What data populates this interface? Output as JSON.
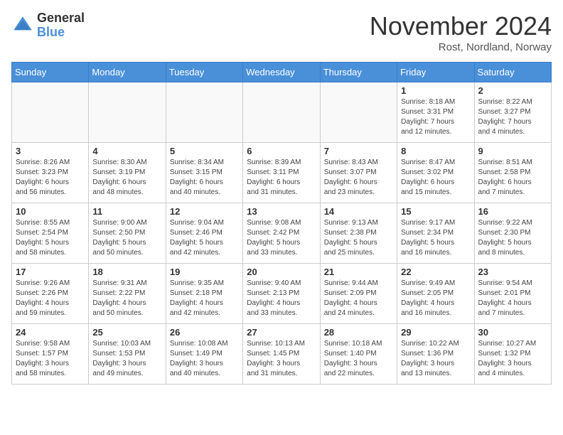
{
  "logo": {
    "general": "General",
    "blue": "Blue"
  },
  "header": {
    "month": "November 2024",
    "location": "Rost, Nordland, Norway"
  },
  "weekdays": [
    "Sunday",
    "Monday",
    "Tuesday",
    "Wednesday",
    "Thursday",
    "Friday",
    "Saturday"
  ],
  "weeks": [
    [
      {
        "day": "",
        "info": ""
      },
      {
        "day": "",
        "info": ""
      },
      {
        "day": "",
        "info": ""
      },
      {
        "day": "",
        "info": ""
      },
      {
        "day": "",
        "info": ""
      },
      {
        "day": "1",
        "info": "Sunrise: 8:18 AM\nSunset: 3:31 PM\nDaylight: 7 hours\nand 12 minutes."
      },
      {
        "day": "2",
        "info": "Sunrise: 8:22 AM\nSunset: 3:27 PM\nDaylight: 7 hours\nand 4 minutes."
      }
    ],
    [
      {
        "day": "3",
        "info": "Sunrise: 8:26 AM\nSunset: 3:23 PM\nDaylight: 6 hours\nand 56 minutes."
      },
      {
        "day": "4",
        "info": "Sunrise: 8:30 AM\nSunset: 3:19 PM\nDaylight: 6 hours\nand 48 minutes."
      },
      {
        "day": "5",
        "info": "Sunrise: 8:34 AM\nSunset: 3:15 PM\nDaylight: 6 hours\nand 40 minutes."
      },
      {
        "day": "6",
        "info": "Sunrise: 8:39 AM\nSunset: 3:11 PM\nDaylight: 6 hours\nand 31 minutes."
      },
      {
        "day": "7",
        "info": "Sunrise: 8:43 AM\nSunset: 3:07 PM\nDaylight: 6 hours\nand 23 minutes."
      },
      {
        "day": "8",
        "info": "Sunrise: 8:47 AM\nSunset: 3:02 PM\nDaylight: 6 hours\nand 15 minutes."
      },
      {
        "day": "9",
        "info": "Sunrise: 8:51 AM\nSunset: 2:58 PM\nDaylight: 6 hours\nand 7 minutes."
      }
    ],
    [
      {
        "day": "10",
        "info": "Sunrise: 8:55 AM\nSunset: 2:54 PM\nDaylight: 5 hours\nand 58 minutes."
      },
      {
        "day": "11",
        "info": "Sunrise: 9:00 AM\nSunset: 2:50 PM\nDaylight: 5 hours\nand 50 minutes."
      },
      {
        "day": "12",
        "info": "Sunrise: 9:04 AM\nSunset: 2:46 PM\nDaylight: 5 hours\nand 42 minutes."
      },
      {
        "day": "13",
        "info": "Sunrise: 9:08 AM\nSunset: 2:42 PM\nDaylight: 5 hours\nand 33 minutes."
      },
      {
        "day": "14",
        "info": "Sunrise: 9:13 AM\nSunset: 2:38 PM\nDaylight: 5 hours\nand 25 minutes."
      },
      {
        "day": "15",
        "info": "Sunrise: 9:17 AM\nSunset: 2:34 PM\nDaylight: 5 hours\nand 16 minutes."
      },
      {
        "day": "16",
        "info": "Sunrise: 9:22 AM\nSunset: 2:30 PM\nDaylight: 5 hours\nand 8 minutes."
      }
    ],
    [
      {
        "day": "17",
        "info": "Sunrise: 9:26 AM\nSunset: 2:26 PM\nDaylight: 4 hours\nand 59 minutes."
      },
      {
        "day": "18",
        "info": "Sunrise: 9:31 AM\nSunset: 2:22 PM\nDaylight: 4 hours\nand 50 minutes."
      },
      {
        "day": "19",
        "info": "Sunrise: 9:35 AM\nSunset: 2:18 PM\nDaylight: 4 hours\nand 42 minutes."
      },
      {
        "day": "20",
        "info": "Sunrise: 9:40 AM\nSunset: 2:13 PM\nDaylight: 4 hours\nand 33 minutes."
      },
      {
        "day": "21",
        "info": "Sunrise: 9:44 AM\nSunset: 2:09 PM\nDaylight: 4 hours\nand 24 minutes."
      },
      {
        "day": "22",
        "info": "Sunrise: 9:49 AM\nSunset: 2:05 PM\nDaylight: 4 hours\nand 16 minutes."
      },
      {
        "day": "23",
        "info": "Sunrise: 9:54 AM\nSunset: 2:01 PM\nDaylight: 4 hours\nand 7 minutes."
      }
    ],
    [
      {
        "day": "24",
        "info": "Sunrise: 9:58 AM\nSunset: 1:57 PM\nDaylight: 3 hours\nand 58 minutes."
      },
      {
        "day": "25",
        "info": "Sunrise: 10:03 AM\nSunset: 1:53 PM\nDaylight: 3 hours\nand 49 minutes."
      },
      {
        "day": "26",
        "info": "Sunrise: 10:08 AM\nSunset: 1:49 PM\nDaylight: 3 hours\nand 40 minutes."
      },
      {
        "day": "27",
        "info": "Sunrise: 10:13 AM\nSunset: 1:45 PM\nDaylight: 3 hours\nand 31 minutes."
      },
      {
        "day": "28",
        "info": "Sunrise: 10:18 AM\nSunset: 1:40 PM\nDaylight: 3 hours\nand 22 minutes."
      },
      {
        "day": "29",
        "info": "Sunrise: 10:22 AM\nSunset: 1:36 PM\nDaylight: 3 hours\nand 13 minutes."
      },
      {
        "day": "30",
        "info": "Sunrise: 10:27 AM\nSunset: 1:32 PM\nDaylight: 3 hours\nand 4 minutes."
      }
    ]
  ]
}
